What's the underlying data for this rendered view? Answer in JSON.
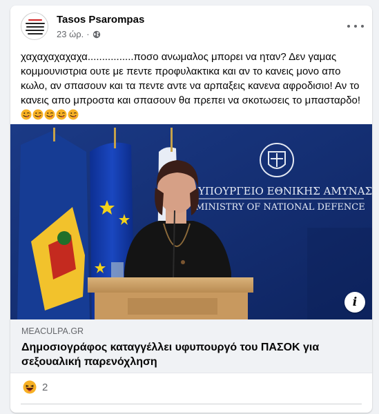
{
  "post": {
    "author": "Tasos Psarompas",
    "time": "23 ώρ.",
    "separator": "·",
    "privacy_icon": "globe-icon",
    "text": "χαχαχαχαχαχα................ποσο ανωμαλος μπορει να ηταν? Δεν γαμας κομμουνιστρια ουτε με πεντε προφυλακτικα και αν το κανεις μονο απο κωλο, αν σπασουν και τα πεντε αντε να αρπαξεις κανενα αφροδισιο! Αν το κανεις απο μπροστα και σπασουν θα πρεπει να σκοτωσεις το μπασταρδο!",
    "trailing_emoji_count": 5,
    "trailing_emoji_icon": "winking-tongue-face-icon"
  },
  "photo": {
    "wall_sign_greek": "ΥΠΟΥΡΓΕΙΟ ΕΘΝΙΚΗΣ ΑΜΥΝΑΣ",
    "wall_sign_english": "MINISTRY OF NATIONAL DEFENCE",
    "info_label": "i"
  },
  "link": {
    "domain": "MEACULPA.GR",
    "title": "Δημοσιογράφος καταγγέλλει υφυπουργό του ΠΑΣΟΚ για σεξουαλική παρενόχληση"
  },
  "reactions": {
    "icon": "haha-reaction-icon",
    "count": "2"
  },
  "colors": {
    "author": "#050505",
    "secondary": "#65676b",
    "link_box_bg": "#f0f2f5",
    "photo_wall": "#132b6e",
    "emoji_yellow": "#f7b125"
  }
}
